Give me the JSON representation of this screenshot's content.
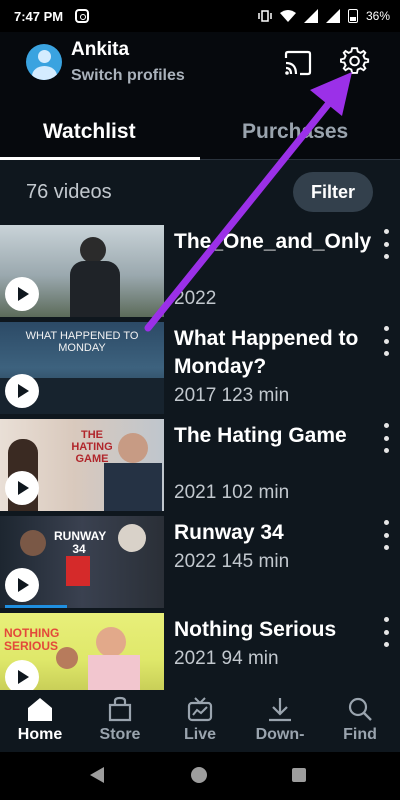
{
  "status_bar": {
    "time": "7:47 PM",
    "battery": "36%"
  },
  "header": {
    "profile_name": "Ankita",
    "switch_label": "Switch profiles"
  },
  "tabs": [
    {
      "label": "Watchlist"
    },
    {
      "label": "Purchases"
    }
  ],
  "list_header": {
    "count": "76 videos",
    "filter_label": "Filter"
  },
  "items": [
    {
      "title": "The_One_and_Only",
      "meta": "2022",
      "thumb_text": ""
    },
    {
      "title": "What Happened to Monday?",
      "meta": "2017 123 min",
      "thumb_text": "WHAT HAPPENED TO MONDAY"
    },
    {
      "title": "The Hating Game",
      "meta": "2021 102 min",
      "thumb_text": "THE HATING GAME"
    },
    {
      "title": "Runway 34",
      "meta": "2022 145 min",
      "thumb_text": "RUNWAY 34"
    },
    {
      "title": "Nothing Serious",
      "meta": "2021 94 min",
      "thumb_text": "NOTHING SERIOUS"
    }
  ],
  "progress": [
    0.0,
    0.0,
    0.0,
    0.4,
    0.0
  ],
  "bottom_nav": [
    {
      "label": "Home",
      "icon": "home-icon"
    },
    {
      "label": "Store",
      "icon": "store-icon"
    },
    {
      "label": "Live",
      "icon": "live-tv-icon"
    },
    {
      "label": "Down-",
      "icon": "download-icon"
    },
    {
      "label": "Find",
      "icon": "search-icon"
    }
  ],
  "colors": {
    "background": "#0f171e",
    "accent": "#1f8fe0",
    "annotation": "#9b30e8"
  }
}
